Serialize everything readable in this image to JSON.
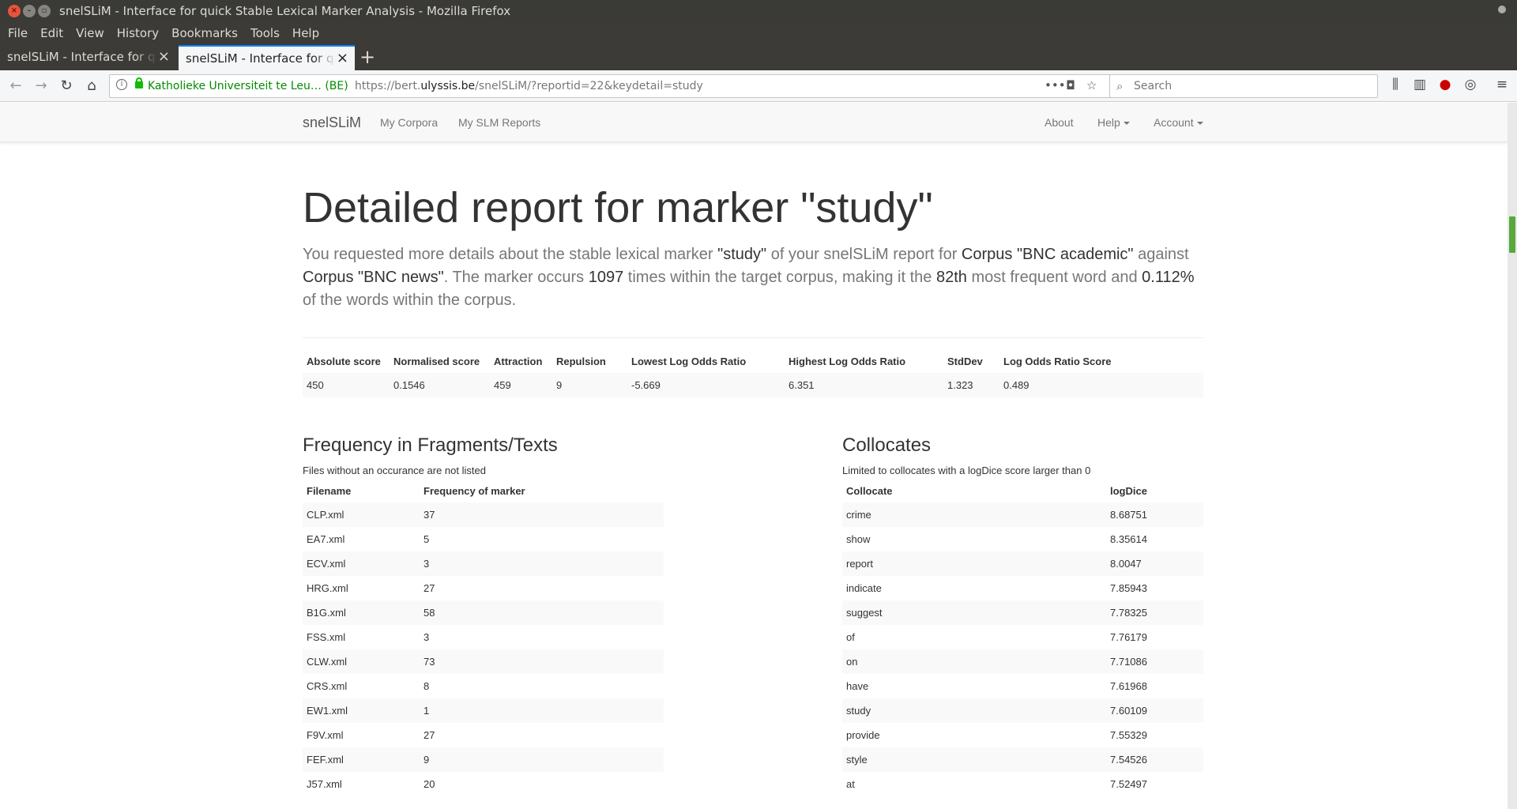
{
  "window": {
    "title": "snelSLiM - Interface for quick Stable Lexical Marker Analysis - Mozilla Firefox"
  },
  "menubar": [
    "File",
    "Edit",
    "View",
    "History",
    "Bookmarks",
    "Tools",
    "Help"
  ],
  "tabs": [
    {
      "title": "snelSLiM - Interface for quick Stable Lexical Marker Analysis"
    },
    {
      "title": "snelSLiM - Interface for quick Stable Lexical Marker Analysis"
    }
  ],
  "navbar": {
    "site_identity": "Katholieke Universiteit te Leu…  (BE)",
    "url_prefix": "https://bert.",
    "url_domain": "ulyssis.be",
    "url_path": "/snelSLiM/?reportid=22&keydetail=study",
    "search_placeholder": "Search"
  },
  "site_nav": {
    "brand": "snelSLiM",
    "left_links": [
      "My Corpora",
      "My SLM Reports"
    ],
    "about": "About",
    "help": "Help",
    "account": "Account"
  },
  "report": {
    "title": "Detailed report for marker \"study\"",
    "lead": {
      "t1": "You requested more details about the stable lexical marker ",
      "marker": "\"study\"",
      "t2": " of your snelSLiM report for ",
      "corpus_a": "Corpus \"BNC academic\"",
      "t3": " against ",
      "corpus_b": "Corpus \"BNC news\"",
      "t4": ". The marker occurs ",
      "count": "1097",
      "t5": " times within the target corpus, making it the ",
      "rank": "82th",
      "t6": " most frequent word and ",
      "percent": "0.112%",
      "t7": " of the words within the corpus."
    }
  },
  "scores": {
    "headers": [
      "Absolute score",
      "Normalised score",
      "Attraction",
      "Repulsion",
      "Lowest Log Odds Ratio",
      "Highest Log Odds Ratio",
      "StdDev",
      "Log Odds Ratio Score"
    ],
    "values": [
      "450",
      "0.1546",
      "459",
      "9",
      "-5.669",
      "6.351",
      "1.323",
      "0.489"
    ]
  },
  "frequency": {
    "title": "Frequency in Fragments/Texts",
    "note": "Files without an occurance are not listed",
    "headers": [
      "Filename",
      "Frequency of marker"
    ],
    "rows": [
      [
        "CLP.xml",
        "37"
      ],
      [
        "EA7.xml",
        "5"
      ],
      [
        "ECV.xml",
        "3"
      ],
      [
        "HRG.xml",
        "27"
      ],
      [
        "B1G.xml",
        "58"
      ],
      [
        "FSS.xml",
        "3"
      ],
      [
        "CLW.xml",
        "73"
      ],
      [
        "CRS.xml",
        "8"
      ],
      [
        "EW1.xml",
        "1"
      ],
      [
        "F9V.xml",
        "27"
      ],
      [
        "FEF.xml",
        "9"
      ],
      [
        "J57.xml",
        "20"
      ]
    ]
  },
  "collocates": {
    "title": "Collocates",
    "note": "Limited to collocates with a logDice score larger than 0",
    "headers": [
      "Collocate",
      "logDice"
    ],
    "rows": [
      [
        "crime",
        "8.68751"
      ],
      [
        "show",
        "8.35614"
      ],
      [
        "report",
        "8.0047"
      ],
      [
        "indicate",
        "7.85943"
      ],
      [
        "suggest",
        "7.78325"
      ],
      [
        "of",
        "7.76179"
      ],
      [
        "on",
        "7.71086"
      ],
      [
        "have",
        "7.61968"
      ],
      [
        "study",
        "7.60109"
      ],
      [
        "provide",
        "7.55329"
      ],
      [
        "style",
        "7.54526"
      ],
      [
        "at",
        "7.52497"
      ]
    ]
  }
}
